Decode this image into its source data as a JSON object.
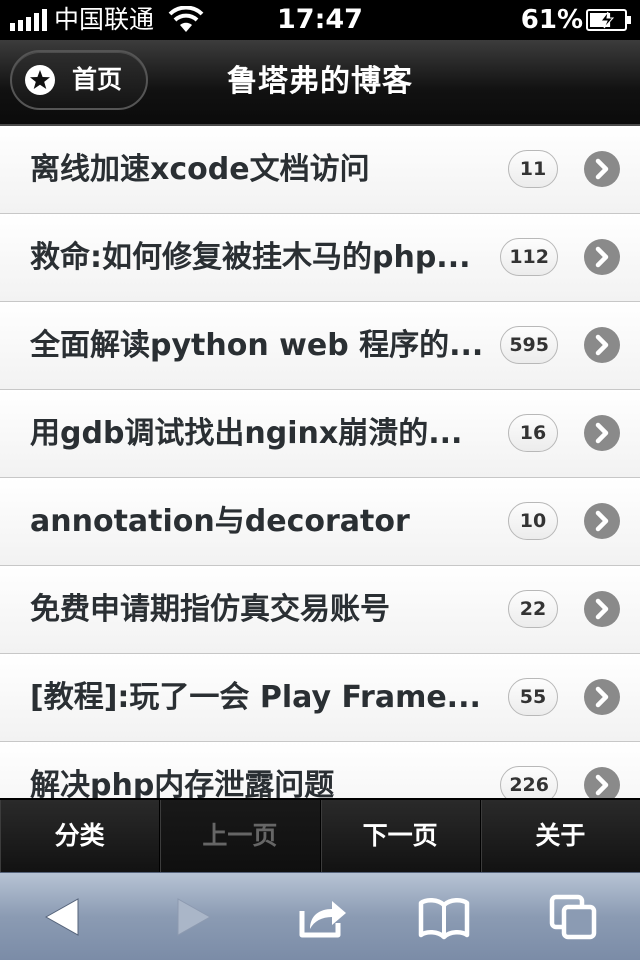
{
  "status_bar": {
    "carrier": "中国联通",
    "time": "17:47",
    "battery": "61%",
    "battery_level": 0.61
  },
  "header": {
    "home_label": "首页",
    "title": "鲁塔弗的博客"
  },
  "posts": [
    {
      "title": "离线加速xcode文档访问",
      "count": "11"
    },
    {
      "title": "救命:如何修复被挂木马的php...",
      "count": "112"
    },
    {
      "title": "全面解读python web 程序的...",
      "count": "595"
    },
    {
      "title": "用gdb调试找出nginx崩溃的...",
      "count": "16"
    },
    {
      "title": "annotation与decorator",
      "count": "10"
    },
    {
      "title": "免费申请期指仿真交易账号",
      "count": "22"
    },
    {
      "title": "[教程]:玩了一会 Play Frame...",
      "count": "55"
    },
    {
      "title": "解决php内存泄露问题",
      "count": "226"
    }
  ],
  "bottom_nav": {
    "category": "分类",
    "prev": "上一页",
    "next": "下一页",
    "about": "关于",
    "prev_disabled": true
  },
  "toolbar": {
    "icons": [
      "back-icon",
      "forward-icon",
      "share-icon",
      "bookmarks-icon",
      "tabs-icon"
    ]
  },
  "colors": {
    "header_bg": "#111111",
    "list_bg": "#ffffff",
    "text": "#2a2f33",
    "toolbar_bg": "#8b9bb3"
  }
}
